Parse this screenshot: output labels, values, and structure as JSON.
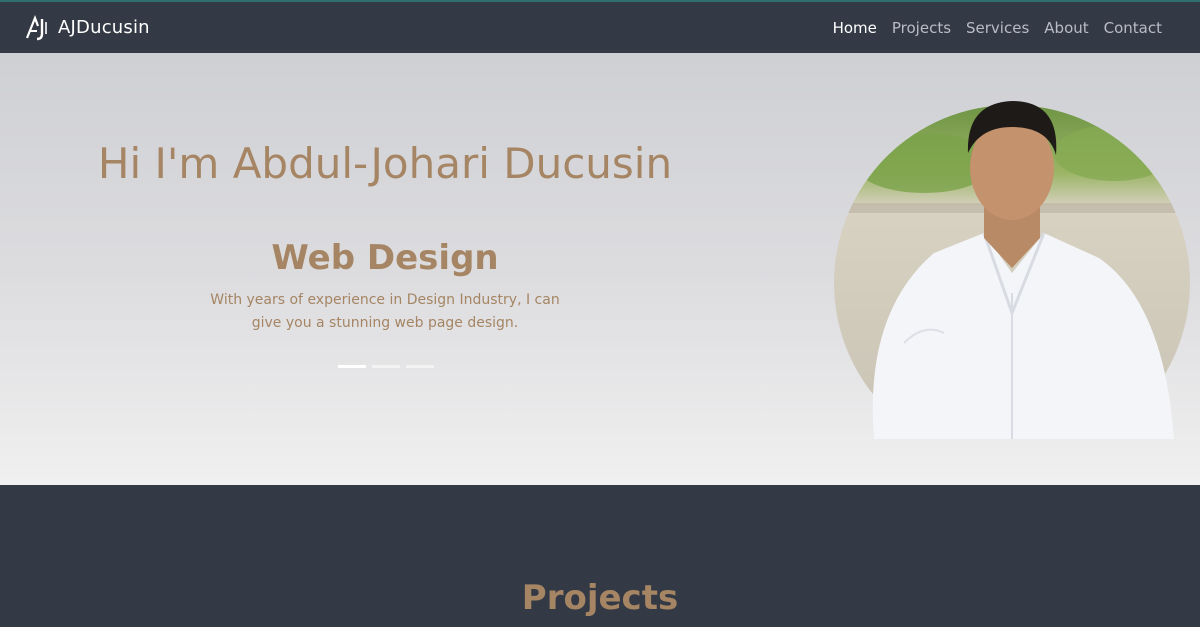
{
  "nav": {
    "brand": "AJDucusin",
    "links": [
      "Home",
      "Projects",
      "Services",
      "About",
      "Contact"
    ],
    "active_index": 0
  },
  "hero": {
    "title": "Hi I'm Abdul-Johari Ducusin",
    "slide": {
      "heading": "Web Design",
      "description": "With years of experience in Design Industry, I can give you a stunning web page design."
    },
    "indicators_count": 3,
    "active_indicator": 0
  },
  "projects": {
    "title": "Projects"
  },
  "colors": {
    "navbar": "#343a45",
    "accent": "#a58563",
    "nav_inactive": "#b7bcc6"
  }
}
